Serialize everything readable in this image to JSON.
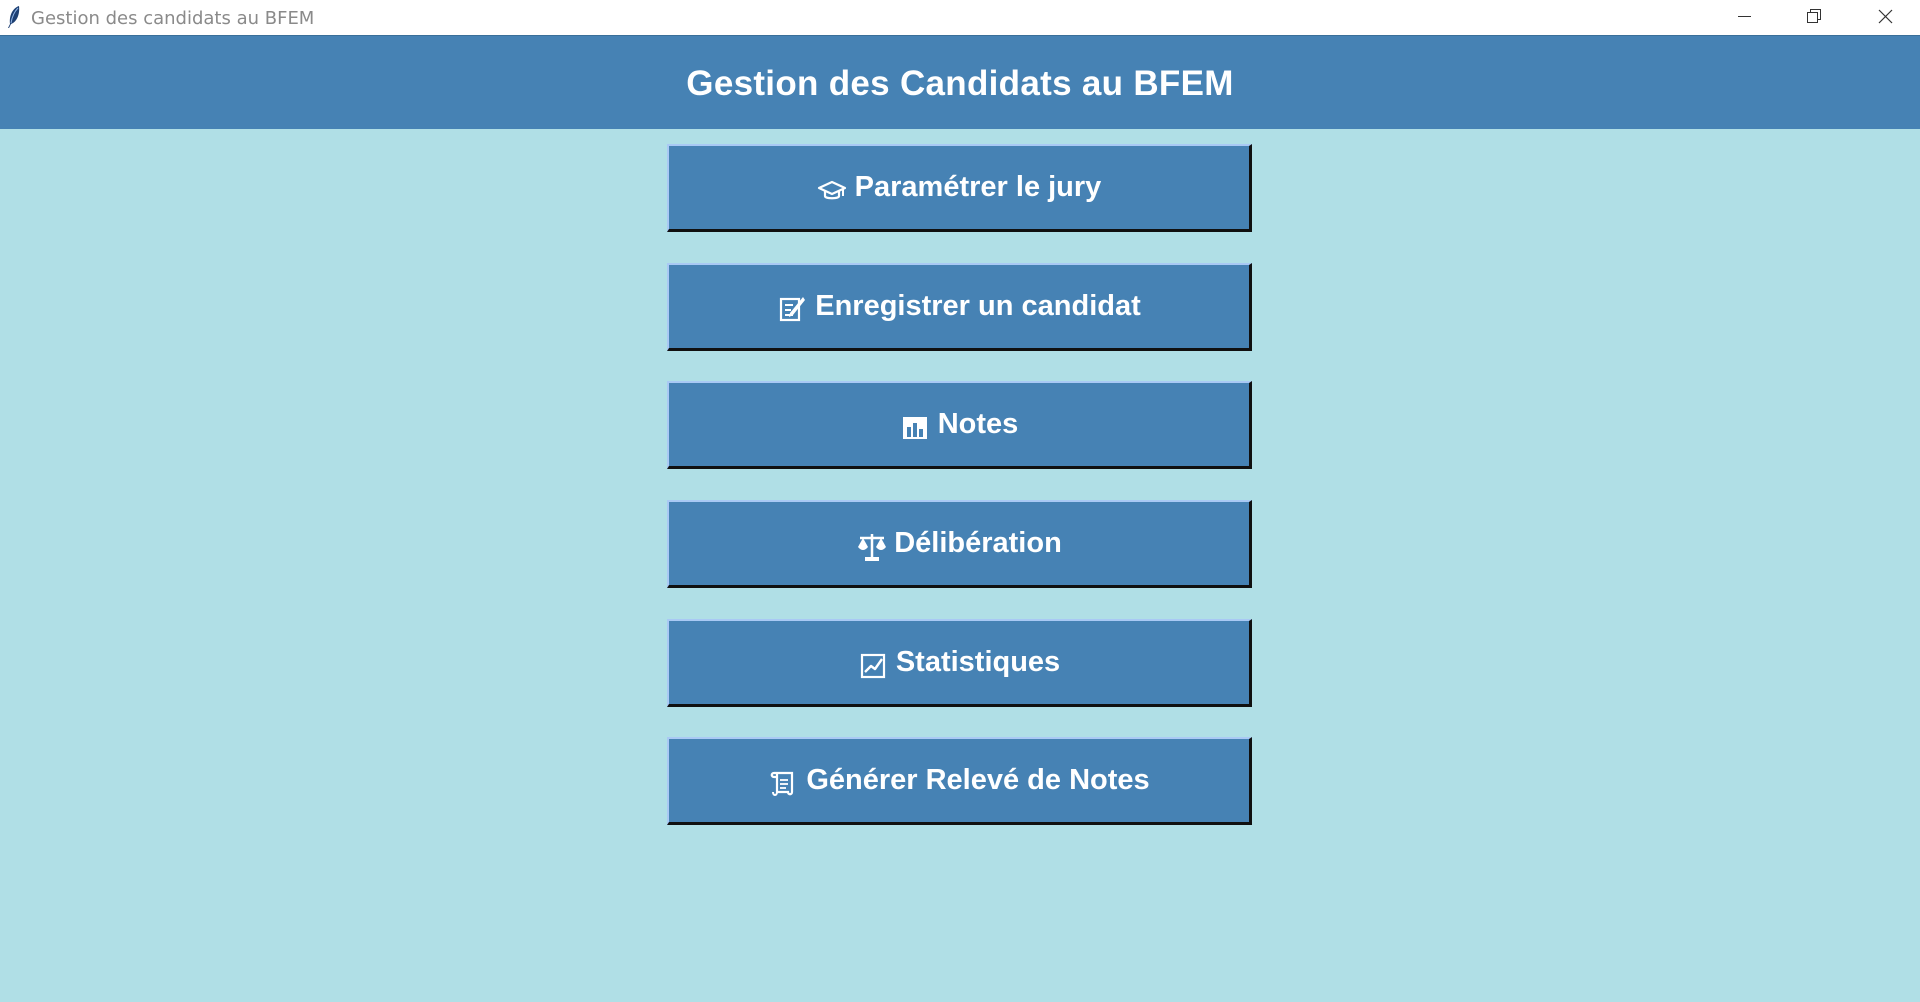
{
  "window": {
    "title": "Gestion des candidats au BFEM"
  },
  "header": {
    "title": "Gestion des Candidats au BFEM",
    "background": "#4682b4"
  },
  "theme": {
    "background": "#b0dfe6",
    "button_color": "#4682b4",
    "text_color": "#ffffff"
  },
  "menu": {
    "items": [
      {
        "label": "Paramétrer le jury",
        "icon": "graduation-cap-icon"
      },
      {
        "label": "Enregistrer un candidat",
        "icon": "memo-icon"
      },
      {
        "label": "Notes",
        "icon": "bar-chart-icon"
      },
      {
        "label": "Délibération",
        "icon": "balance-scale-icon"
      },
      {
        "label": "Statistiques",
        "icon": "chart-increasing-icon"
      },
      {
        "label": "Générer Relevé de Notes",
        "icon": "scroll-icon"
      }
    ]
  }
}
